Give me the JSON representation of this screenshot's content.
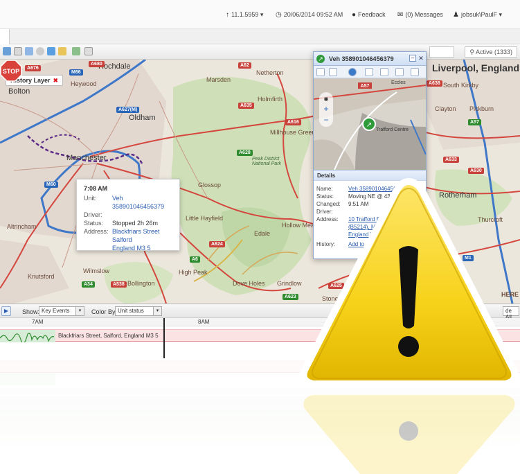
{
  "topbar": {
    "version": "11.1.5959",
    "datetime": "20/06/2014 09:52 AM",
    "feedback": "Feedback",
    "messages": "(0) Messages",
    "user": "jobsuk\\PaulF"
  },
  "toolbar": {
    "active_count": "Active (1333)"
  },
  "map": {
    "history_layer": "History Layer",
    "places": {
      "liverpool": "Liverpool, England",
      "rochdale": "Rochdale",
      "bolton": "Bolton",
      "heywood": "Heywood",
      "oldham": "Oldham",
      "manchester": "Manchester",
      "netherton": "Netherton",
      "marsden": "Marsden",
      "holmfirth": "Holmfirth",
      "millhouse_green": "Millhouse Green",
      "glossop": "Glossop",
      "little_hayfield": "Little Hayfield",
      "edale": "Edale",
      "hollow_meadows": "Hollow Mea",
      "high_peak": "High Peak",
      "dove_holes": "Dove Holes",
      "grindlow": "Grindlow",
      "altrincham": "Altrincham",
      "wilmslow": "Wilmslow",
      "knutsford": "Knutsford",
      "bollington": "Bollington",
      "peak_district": "Peak District National Park",
      "clayton": "Clayton",
      "pickburn": "Pickburn",
      "rotherham": "Rotherham",
      "thurcroft": "Thurcroft",
      "south_kirkby": "South Kirkby",
      "stoney": "Stoney",
      "here": "HERE"
    },
    "roads": {
      "a676": "A676",
      "a680": "A680",
      "m66": "M66",
      "a62": "A62",
      "a627m": "A627(M)",
      "a635": "A635",
      "a616": "A616",
      "a628": "A628",
      "m60": "M60",
      "a624": "A624",
      "a6": "A6",
      "a34": "A34",
      "a538": "A538",
      "a625": "A625",
      "a623": "A623",
      "a57": "A57",
      "a638": "A638",
      "a633": "A633",
      "a630": "A630",
      "m1": "M1"
    },
    "stop_label": "STOP"
  },
  "event_popup": {
    "time": "7:08 AM",
    "unit_label": "Unit:",
    "unit_value": "Veh 358901046456379",
    "driver_label": "Driver:",
    "driver_value": "",
    "status_label": "Status:",
    "status_value": "Stopped 2h 26m",
    "address_label": "Address:",
    "address_line1": "Blackfriars Street",
    "address_line2": "Salford",
    "address_line3": "England M3 5"
  },
  "vehicle_panel": {
    "title": "Veh 358901046456379",
    "map_label_a57": "A57",
    "map_label_eccles": "Eccles",
    "map_label_trafford": "Trafford Centre",
    "details_heading": "Details",
    "name_label": "Name:",
    "name_value": "Veh 358901046456379",
    "status_label": "Status:",
    "status_value": "Moving NE @ 43kph",
    "changed_label": "Changed:",
    "changed_value": "9:51 AM",
    "driver_label": "Driver:",
    "driver_value": "",
    "address_label": "Address:",
    "address_line1": "10 Trafford B",
    "address_line2": "(B5214), Ma",
    "address_line3": "England M",
    "history_label": "History:",
    "history_value": "Add to H"
  },
  "timeline": {
    "show_label": "Show:",
    "show_value": "Key Events",
    "color_label": "Color By:",
    "color_value": "Unit status",
    "tick_7am": "7AM",
    "tick_8am": "8AM",
    "event_label": "Blackfriars Street, Salford, England M3 5",
    "hide_all": "de All"
  },
  "colors": {
    "warning_yellow": "#f7d21a",
    "warning_border": "#ffffff",
    "route_purple": "#5b2a86",
    "stop_red": "#d9423a",
    "link_blue": "#2a5db0"
  }
}
